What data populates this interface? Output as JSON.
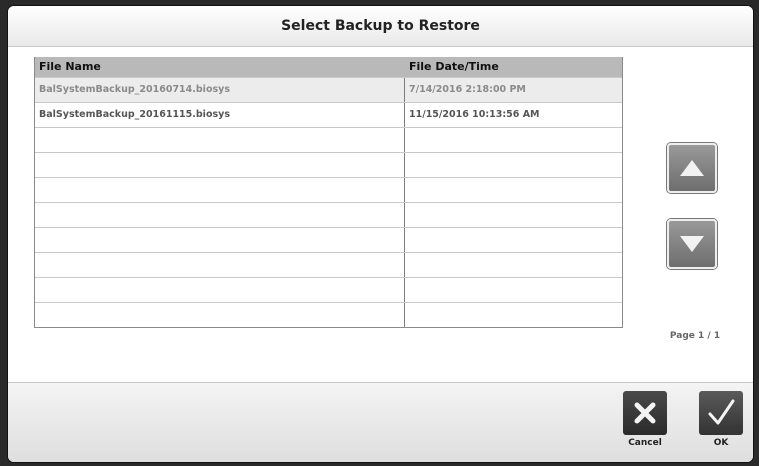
{
  "dialog": {
    "title": "Select Backup to Restore"
  },
  "table": {
    "columns": [
      "File Name",
      "File Date/Time"
    ],
    "rows": [
      {
        "file_name": "BalSystemBackup_20160714.biosys",
        "date_time": "7/14/2016 2:18:00 PM",
        "selected": true
      },
      {
        "file_name": "BalSystemBackup_20161115.biosys",
        "date_time": "11/15/2016 10:13:56 AM",
        "selected": false
      },
      {
        "file_name": "",
        "date_time": "",
        "selected": false
      },
      {
        "file_name": "",
        "date_time": "",
        "selected": false
      },
      {
        "file_name": "",
        "date_time": "",
        "selected": false
      },
      {
        "file_name": "",
        "date_time": "",
        "selected": false
      },
      {
        "file_name": "",
        "date_time": "",
        "selected": false
      },
      {
        "file_name": "",
        "date_time": "",
        "selected": false
      },
      {
        "file_name": "",
        "date_time": "",
        "selected": false
      },
      {
        "file_name": "",
        "date_time": "",
        "selected": false
      }
    ]
  },
  "pagination": {
    "label": "Page 1 / 1",
    "up_icon": "triangle-up-icon",
    "down_icon": "triangle-down-icon"
  },
  "footer": {
    "cancel_label": "Cancel",
    "ok_label": "OK",
    "cancel_icon": "x-icon",
    "ok_icon": "checkmark-icon"
  },
  "colors": {
    "header_bg": "#b9b9b9",
    "selected_row_bg": "#ececec",
    "button_dark": "#2a2a2a"
  }
}
